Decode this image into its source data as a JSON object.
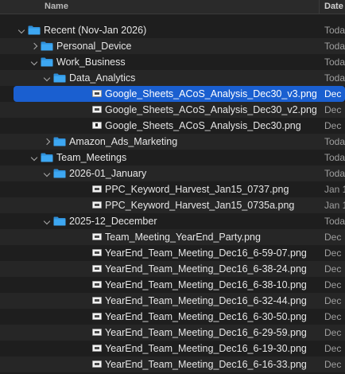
{
  "header": {
    "name_label": "Name",
    "date_label": "Date"
  },
  "colors": {
    "folder": "#3da7f2",
    "selection": "#1a5fd0"
  },
  "rows": [
    {
      "name": "Recent (Nov-Jan 2026)",
      "date": "Toda",
      "kind": "folder",
      "level": 0,
      "expanded": true
    },
    {
      "name": "Personal_Device",
      "date": "Toda",
      "kind": "folder",
      "level": 1,
      "expanded": false
    },
    {
      "name": "Work_Business",
      "date": "Toda",
      "kind": "folder",
      "level": 1,
      "expanded": true
    },
    {
      "name": "Data_Analytics",
      "date": "Toda",
      "kind": "folder",
      "level": 2,
      "expanded": true
    },
    {
      "name": "Google_Sheets_ACoS_Analysis_Dec30_v3.png",
      "date": "Dec",
      "kind": "file",
      "level": 3,
      "selected": true
    },
    {
      "name": "Google_Sheets_ACoS_Analysis_Dec30_v2.png",
      "date": "Dec",
      "kind": "file",
      "level": 3
    },
    {
      "name": "Google_Sheets_ACoS_Analysis_Dec30.png",
      "date": "Dec",
      "kind": "file",
      "level": 3
    },
    {
      "name": "Amazon_Ads_Marketing",
      "date": "Toda",
      "kind": "folder",
      "level": 2,
      "expanded": false
    },
    {
      "name": "Team_Meetings",
      "date": "Toda",
      "kind": "folder",
      "level": 1,
      "expanded": true
    },
    {
      "name": "2026-01_January",
      "date": "Toda",
      "kind": "folder",
      "level": 2,
      "expanded": true
    },
    {
      "name": "PPC_Keyword_Harvest_Jan15_0737.png",
      "date": "Jan 1",
      "kind": "file",
      "level": 3
    },
    {
      "name": "PPC_Keyword_Harvest_Jan15_0735a.png",
      "date": "Jan 1",
      "kind": "file",
      "level": 3
    },
    {
      "name": "2025-12_December",
      "date": "Toda",
      "kind": "folder",
      "level": 2,
      "expanded": true
    },
    {
      "name": "Team_Meeting_YearEnd_Party.png",
      "date": "Dec",
      "kind": "file",
      "level": 3
    },
    {
      "name": "YearEnd_Team_Meeting_Dec16_6-59-07.png",
      "date": "Dec",
      "kind": "file",
      "level": 3
    },
    {
      "name": "YearEnd_Team_Meeting_Dec16_6-38-24.png",
      "date": "Dec",
      "kind": "file",
      "level": 3
    },
    {
      "name": "YearEnd_Team_Meeting_Dec16_6-38-10.png",
      "date": "Dec",
      "kind": "file",
      "level": 3
    },
    {
      "name": "YearEnd_Team_Meeting_Dec16_6-32-44.png",
      "date": "Dec",
      "kind": "file",
      "level": 3
    },
    {
      "name": "YearEnd_Team_Meeting_Dec16_6-30-50.png",
      "date": "Dec",
      "kind": "file",
      "level": 3
    },
    {
      "name": "YearEnd_Team_Meeting_Dec16_6-29-59.png",
      "date": "Dec",
      "kind": "file",
      "level": 3
    },
    {
      "name": "YearEnd_Team_Meeting_Dec16_6-19-30.png",
      "date": "Dec",
      "kind": "file",
      "level": 3
    },
    {
      "name": "YearEnd_Team_Meeting_Dec16_6-16-33.png",
      "date": "Dec",
      "kind": "file",
      "level": 3
    }
  ]
}
